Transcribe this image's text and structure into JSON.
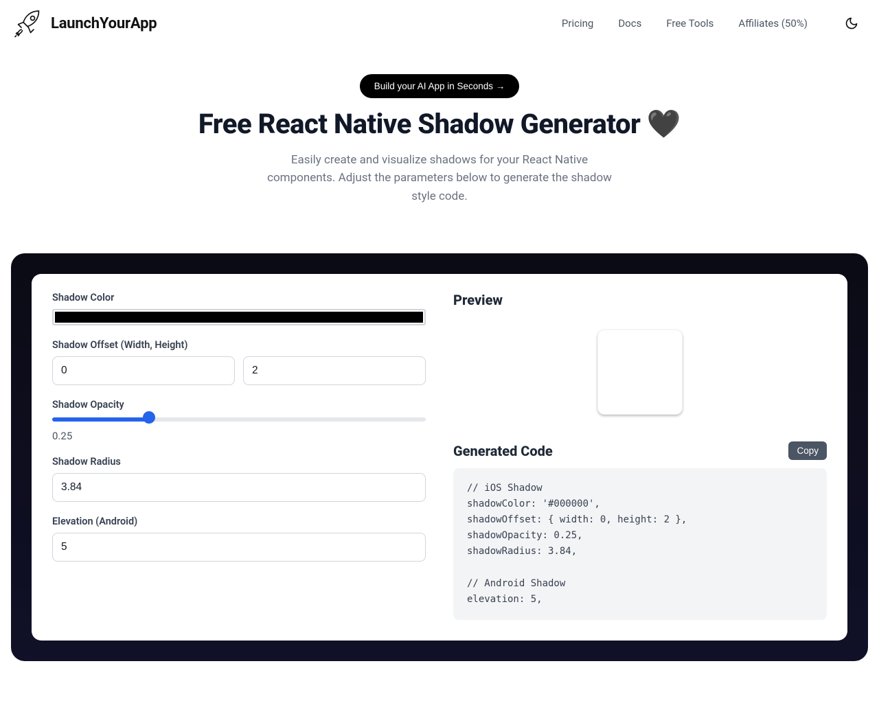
{
  "brand": "LaunchYourApp",
  "nav": {
    "pricing": "Pricing",
    "docs": "Docs",
    "free_tools": "Free Tools",
    "affiliates": "Affiliates (50%)"
  },
  "hero": {
    "cta": "Build your AI App in Seconds →",
    "title": "Free React Native Shadow Generator 🖤",
    "subtitle": "Easily create and visualize shadows for your React Native components. Adjust the parameters below to generate the shadow style code."
  },
  "form": {
    "shadow_color_label": "Shadow Color",
    "shadow_color": "#000000",
    "offset_label": "Shadow Offset (Width, Height)",
    "offset_width": "0",
    "offset_height": "2",
    "opacity_label": "Shadow Opacity",
    "opacity": "0.25",
    "opacity_pct": "25%",
    "radius_label": "Shadow Radius",
    "radius": "3.84",
    "elevation_label": "Elevation (Android)",
    "elevation": "5"
  },
  "right": {
    "preview_title": "Preview",
    "generated_title": "Generated Code",
    "copy": "Copy",
    "code": "// iOS Shadow\nshadowColor: '#000000',\nshadowOffset: { width: 0, height: 2 },\nshadowOpacity: 0.25,\nshadowRadius: 3.84,\n\n// Android Shadow\nelevation: 5,"
  }
}
